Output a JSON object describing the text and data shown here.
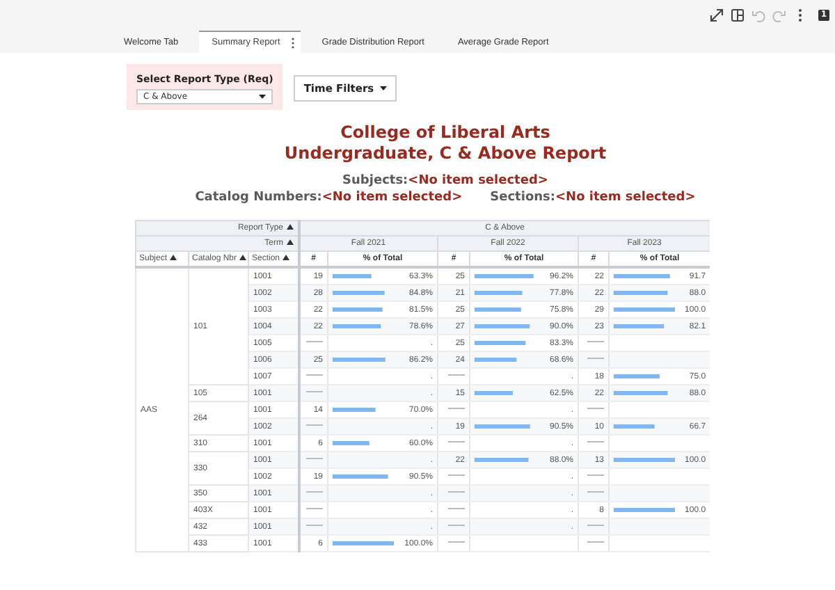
{
  "toolbar": [
    {
      "kind": "expand",
      "disabled": false
    },
    {
      "kind": "layout",
      "disabled": false
    },
    {
      "kind": "undo",
      "disabled": true
    },
    {
      "kind": "redo",
      "disabled": true
    },
    {
      "kind": "more",
      "disabled": false
    }
  ],
  "page_badge": "1",
  "tabs": [
    {
      "label": "Welcome Tab",
      "selected": false
    },
    {
      "label": "Summary Report",
      "selected": true
    },
    {
      "label": "Grade Distribution Report",
      "selected": false
    },
    {
      "label": "Average Grade Report",
      "selected": false
    }
  ],
  "report_type_filter": {
    "label": "Select Report Type (Req)",
    "value": "C & Above"
  },
  "time_filters_button": "Time Filters",
  "title_lines": [
    "College of Liberal Arts",
    "Undergraduate, C & Above Report"
  ],
  "selections": [
    {
      "label": "Subjects:",
      "value": "<No item selected>"
    },
    {
      "label": "Catalog Numbers:",
      "value": "<No item selected>"
    },
    {
      "label": "Sections:",
      "value": "<No item selected>"
    }
  ],
  "table": {
    "report_type_label": "Report Type",
    "report_type": "C & Above",
    "term_label": "Term",
    "terms": [
      {
        "label": "Fall 2021",
        "measure_columns": [
          "#",
          "% of Total"
        ]
      },
      {
        "label": "Fall 2022",
        "measure_columns": [
          "#",
          "% of Total"
        ]
      },
      {
        "label": "Fall 2023",
        "measure_columns": [
          "#",
          "% of Total"
        ]
      }
    ],
    "columns": [
      "Subject",
      "Catalog Nbr",
      "Section"
    ],
    "groups": [
      {
        "subject": "AAS",
        "catalogs": [
          {
            "number": "101",
            "sections": [
              {
                "section": "1001",
                "cells": [
                  {
                    "count": "19",
                    "level": 0.633,
                    "percent": "63.3%"
                  },
                  {
                    "count": "25",
                    "level": 0.962,
                    "percent": "96.2%"
                  },
                  {
                    "count": "22",
                    "level": 0.917,
                    "percent": "91.7"
                  }
                ]
              },
              {
                "section": "1002",
                "cells": [
                  {
                    "count": "28",
                    "level": 0.848,
                    "percent": "84.8%"
                  },
                  {
                    "count": "21",
                    "level": 0.778,
                    "percent": "77.8%"
                  },
                  {
                    "count": "22",
                    "level": 0.88,
                    "percent": "88.0"
                  }
                ]
              },
              {
                "section": "1003",
                "cells": [
                  {
                    "count": "22",
                    "level": 0.815,
                    "percent": "81.5%"
                  },
                  {
                    "count": "25",
                    "level": 0.758,
                    "percent": "75.8%"
                  },
                  {
                    "count": "29",
                    "level": 1,
                    "percent": "100.0"
                  }
                ]
              },
              {
                "section": "1004",
                "cells": [
                  {
                    "count": "22",
                    "level": 0.786,
                    "percent": "78.6%"
                  },
                  {
                    "count": "27",
                    "level": 0.9,
                    "percent": "90.0%"
                  },
                  {
                    "count": "23",
                    "level": 0.821,
                    "percent": "82.1"
                  }
                ]
              },
              {
                "section": "1005",
                "cells": [
                  {
                    "percent": "."
                  },
                  {
                    "count": "25",
                    "level": 0.833,
                    "percent": "83.3%"
                  },
                  {}
                ]
              },
              {
                "section": "1006",
                "cells": [
                  {
                    "count": "25",
                    "level": 0.862,
                    "percent": "86.2%"
                  },
                  {
                    "count": "24",
                    "level": 0.686,
                    "percent": "68.6%"
                  },
                  {}
                ]
              },
              {
                "section": "1007",
                "cells": [
                  {
                    "percent": "."
                  },
                  {
                    "percent": "."
                  },
                  {
                    "count": "18",
                    "level": 0.75,
                    "percent": "75.0"
                  }
                ]
              }
            ]
          },
          {
            "number": "105",
            "sections": [
              {
                "section": "1001",
                "cells": [
                  {
                    "percent": "."
                  },
                  {
                    "count": "15",
                    "level": 0.625,
                    "percent": "62.5%"
                  },
                  {
                    "count": "22",
                    "level": 0.88,
                    "percent": "88.0"
                  }
                ]
              }
            ]
          },
          {
            "number": "264",
            "sections": [
              {
                "section": "1001",
                "cells": [
                  {
                    "count": "14",
                    "level": 0.7,
                    "percent": "70.0%"
                  },
                  {
                    "percent": "."
                  },
                  {}
                ]
              },
              {
                "section": "1002",
                "cells": [
                  {
                    "percent": "."
                  },
                  {
                    "count": "19",
                    "level": 0.905,
                    "percent": "90.5%"
                  },
                  {
                    "count": "10",
                    "level": 0.667,
                    "percent": "66.7"
                  }
                ]
              }
            ]
          },
          {
            "number": "310",
            "sections": [
              {
                "section": "1001",
                "cells": [
                  {
                    "count": "6",
                    "level": 0.6,
                    "percent": "60.0%"
                  },
                  {
                    "percent": "."
                  },
                  {}
                ]
              }
            ]
          },
          {
            "number": "330",
            "sections": [
              {
                "section": "1001",
                "cells": [
                  {
                    "percent": "."
                  },
                  {
                    "count": "22",
                    "level": 0.88,
                    "percent": "88.0%"
                  },
                  {
                    "count": "13",
                    "level": 1,
                    "percent": "100.0"
                  }
                ]
              },
              {
                "section": "1002",
                "cells": [
                  {
                    "count": "19",
                    "level": 0.905,
                    "percent": "90.5%"
                  },
                  {
                    "percent": "."
                  },
                  {}
                ]
              }
            ]
          },
          {
            "number": "350",
            "sections": [
              {
                "section": "1001",
                "cells": [
                  {
                    "percent": "."
                  },
                  {
                    "percent": "."
                  },
                  {}
                ]
              }
            ]
          },
          {
            "number": "403X",
            "sections": [
              {
                "section": "1001",
                "cells": [
                  {
                    "percent": "."
                  },
                  {
                    "percent": "."
                  },
                  {
                    "count": "8",
                    "level": 1,
                    "percent": "100.0"
                  }
                ]
              }
            ]
          },
          {
            "number": "432",
            "sections": [
              {
                "section": "1001",
                "cells": [
                  {
                    "percent": "."
                  },
                  {
                    "percent": "."
                  },
                  {}
                ]
              }
            ]
          },
          {
            "number": "433",
            "sections": [
              {
                "section": "1001",
                "cells": [
                  {
                    "count": "6",
                    "level": 1,
                    "percent": "100.0%"
                  },
                  {},
                  {}
                ]
              }
            ]
          }
        ]
      }
    ]
  }
}
